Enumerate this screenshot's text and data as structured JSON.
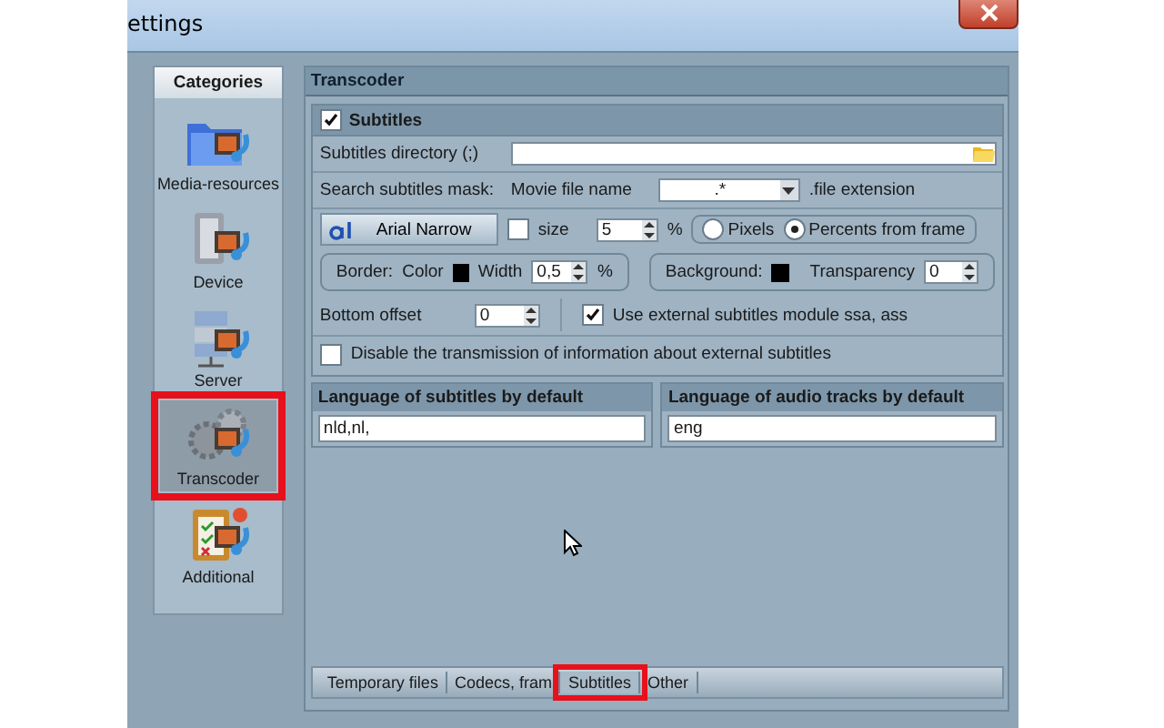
{
  "window": {
    "title": "ettings"
  },
  "sidebar": {
    "heading": "Categories",
    "items": [
      {
        "label": "Media-resources",
        "kind": "folder",
        "selected": false,
        "highlighted": false
      },
      {
        "label": "Device",
        "kind": "device",
        "selected": false,
        "highlighted": false
      },
      {
        "label": "Server",
        "kind": "server",
        "selected": false,
        "highlighted": false
      },
      {
        "label": "Transcoder",
        "kind": "gears",
        "selected": true,
        "highlighted": true
      },
      {
        "label": "Additional",
        "kind": "clipboard",
        "selected": false,
        "highlighted": false
      }
    ]
  },
  "panel": {
    "title": "Transcoder",
    "subtitles": {
      "label": "Subtitles",
      "checked": true,
      "directory": {
        "label": "Subtitles directory (;)"
      },
      "mask": {
        "label": "Search subtitles mask:",
        "prefix": "Movie file name",
        "value": ".*",
        "suffix": ".file extension"
      },
      "font": {
        "button": "Arial Narrow",
        "size_checked": false,
        "size_label": "size",
        "size_value": "5",
        "size_unit": "%"
      },
      "units": [
        {
          "label": "Pixels",
          "selected": false
        },
        {
          "label": "Percents from frame",
          "selected": true
        }
      ],
      "border": {
        "label": "Border:",
        "color_label": "Color",
        "width_label": "Width",
        "width_value": "0,5",
        "unit": "%"
      },
      "background": {
        "label": "Background:",
        "transparency_label": "Transparency",
        "transparency_value": "0"
      },
      "bottom_offset": {
        "label": "Bottom offset",
        "value": "0"
      },
      "external_module": {
        "label": "Use external subtitles module ssa, ass",
        "checked": true
      },
      "disable_transmission": {
        "label": "Disable the transmission of information about external subtitles",
        "checked": false
      }
    },
    "languages": [
      {
        "heading": "Language of subtitles by default",
        "value": "nld,nl,"
      },
      {
        "heading": "Language of audio tracks by default",
        "value": "eng"
      }
    ]
  },
  "tabs": [
    {
      "label": "Temporary files",
      "selected": false,
      "highlighted": false
    },
    {
      "label": "Codecs, fram",
      "selected": false,
      "highlighted": false
    },
    {
      "label": "Subtitles",
      "selected": true,
      "highlighted": true
    },
    {
      "label": "Other",
      "selected": false,
      "highlighted": false
    }
  ]
}
